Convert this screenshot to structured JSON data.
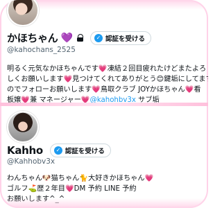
{
  "profile1": {
    "display_name": "かほちゃん",
    "name_emoji": "💜",
    "verify_label": "認証を受ける",
    "handle": "@kahochans_2525",
    "bio_lines": [
      "明るく元気なかほちゃんです💗凍結２回目疲れたけどまたよろ",
      "しくお願いします💗見つけてくれてありがとう😊鍵垢にしてます",
      "のでフォローお願いします💗鳥取クラブ JOYかほちゃん💗看",
      "板嬢💗兼 マネージャー💗"
    ],
    "bio_mention": "@kahohbv3x",
    "bio_tail": " サブ垢"
  },
  "profile2": {
    "display_name": "Kahho",
    "verify_label": "認証を受ける",
    "handle": "@Kahhobv3x",
    "bio_lines": [
      "わんちゃん🐶猫ちゃん🐈大好きかほちゃん💗",
      "ゴルフ⛳歴２年目💗DM 予約 LINE 予約",
      "お願いします^_^"
    ]
  },
  "icons": {
    "lock": "lock-icon",
    "verified_badge": "verified-badge-icon"
  },
  "colors": {
    "accent": "#1d9bf0",
    "secondary_text": "#536471",
    "frame_pink": "#ffd2e8"
  }
}
